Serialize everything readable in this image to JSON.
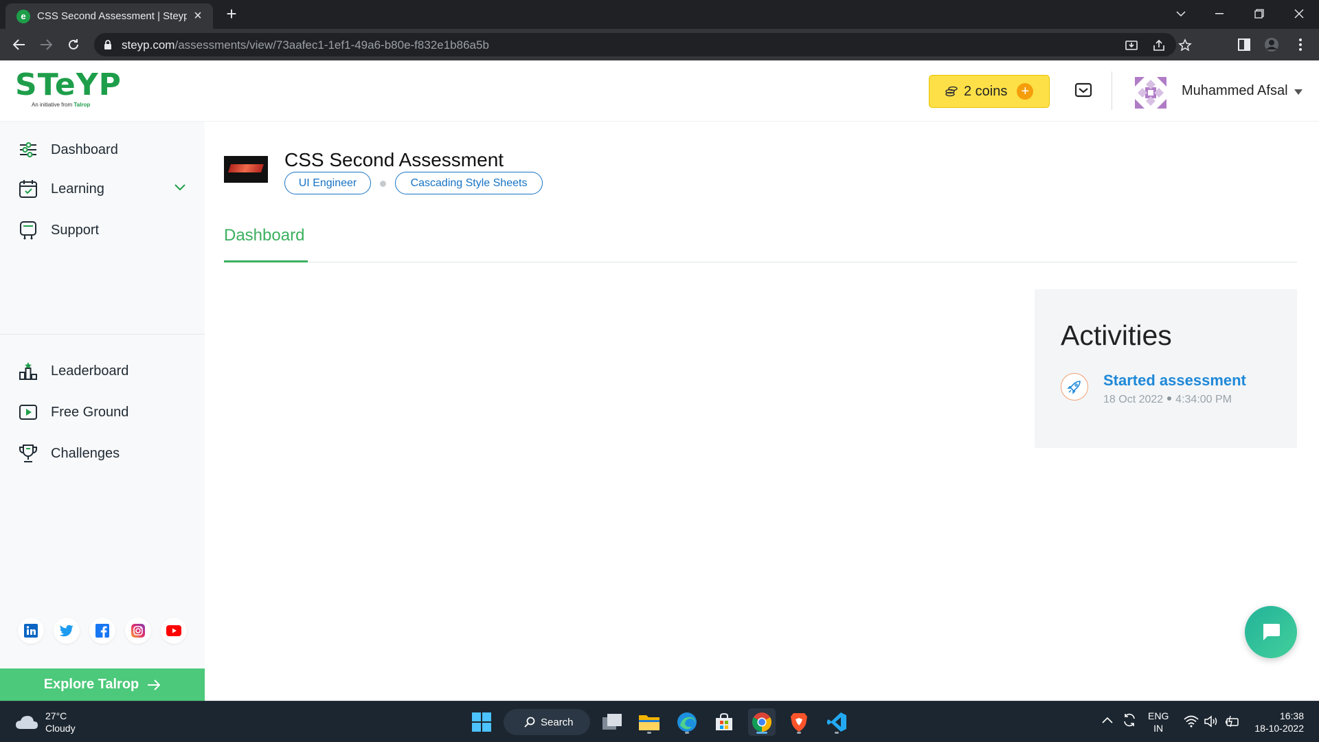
{
  "browser": {
    "tab_title": "CSS Second Assessment | Steyp's",
    "tab_close": "×",
    "new_tab": "+",
    "url_host": "steyp.com",
    "url_path": "/assessments/view/73aafec1-1ef1-49a6-b80e-f832e1b86a5b"
  },
  "header": {
    "logo_text": "STeYP",
    "logo_sub_prefix": "An initiative from",
    "logo_sub_brand": "Talrop",
    "coins_label": "2 coins",
    "coins_plus": "+",
    "user_name": "Muhammed Afsal"
  },
  "sidebar": {
    "primary": [
      {
        "label": "Dashboard",
        "icon": "dashboard-icon"
      },
      {
        "label": "Learning",
        "icon": "calendar-icon"
      },
      {
        "label": "Support",
        "icon": "support-icon"
      }
    ],
    "secondary": [
      {
        "label": "Leaderboard",
        "icon": "leaderboard-icon"
      },
      {
        "label": "Free Ground",
        "icon": "play-icon"
      },
      {
        "label": "Challenges",
        "icon": "trophy-icon"
      }
    ],
    "socials": [
      "linkedin-icon",
      "twitter-icon",
      "facebook-icon",
      "instagram-icon",
      "youtube-icon"
    ],
    "explore_label": "Explore Talrop"
  },
  "assessment": {
    "title": "CSS Second Assessment",
    "tags": [
      "UI Engineer",
      "Cascading Style Sheets"
    ],
    "tab": "Dashboard"
  },
  "activities": {
    "title": "Activities",
    "items": [
      {
        "label": "Started assessment",
        "date": "18 Oct 2022",
        "time": "4:34:00 PM"
      }
    ]
  },
  "taskbar": {
    "temperature": "27°C",
    "condition": "Cloudy",
    "search_label": "Search",
    "lang_line1": "ENG",
    "lang_line2": "IN",
    "time": "16:38",
    "date": "18-10-2022"
  },
  "colors": {
    "brand_green": "#1e9e4a",
    "accent_green": "#3bb05e",
    "link_blue": "#1e88d8",
    "tag_blue": "#1673c5",
    "coins_yellow": "#fde047",
    "explore_green": "#4cc97a"
  }
}
